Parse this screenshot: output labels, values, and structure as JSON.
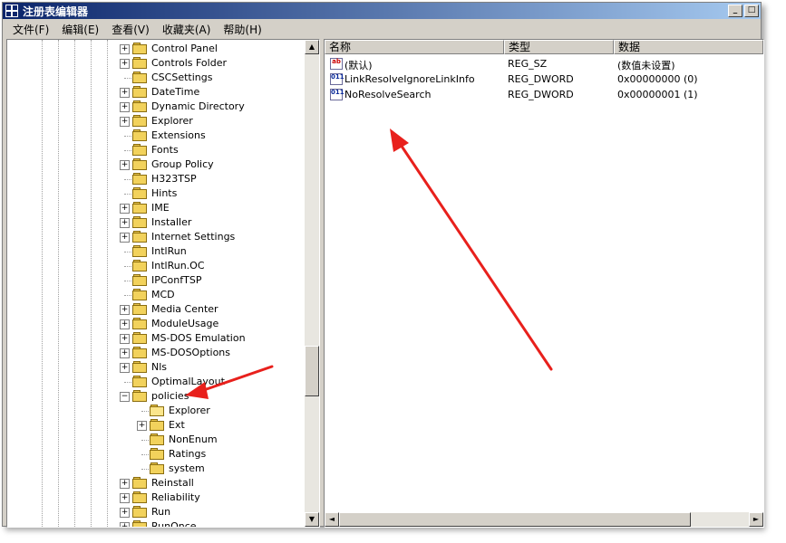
{
  "window": {
    "title": "注册表编辑器",
    "minimize": "_",
    "maximize": "□"
  },
  "menu": [
    "文件(F)",
    "编辑(E)",
    "查看(V)",
    "收藏夹(A)",
    "帮助(H)"
  ],
  "tree": {
    "items": [
      {
        "label": "Control Panel",
        "level": 0,
        "expander": "plus",
        "open": false
      },
      {
        "label": "Controls Folder",
        "level": 0,
        "expander": "plus",
        "open": false
      },
      {
        "label": "CSCSettings",
        "level": 0,
        "expander": "none",
        "open": false
      },
      {
        "label": "DateTime",
        "level": 0,
        "expander": "plus",
        "open": false
      },
      {
        "label": "Dynamic Directory",
        "level": 0,
        "expander": "plus",
        "open": false
      },
      {
        "label": "Explorer",
        "level": 0,
        "expander": "plus",
        "open": false
      },
      {
        "label": "Extensions",
        "level": 0,
        "expander": "none",
        "open": false
      },
      {
        "label": "Fonts",
        "level": 0,
        "expander": "none",
        "open": false
      },
      {
        "label": "Group Policy",
        "level": 0,
        "expander": "plus",
        "open": false
      },
      {
        "label": "H323TSP",
        "level": 0,
        "expander": "none",
        "open": false
      },
      {
        "label": "Hints",
        "level": 0,
        "expander": "none",
        "open": false
      },
      {
        "label": "IME",
        "level": 0,
        "expander": "plus",
        "open": false
      },
      {
        "label": "Installer",
        "level": 0,
        "expander": "plus",
        "open": false
      },
      {
        "label": "Internet Settings",
        "level": 0,
        "expander": "plus",
        "open": false
      },
      {
        "label": "IntlRun",
        "level": 0,
        "expander": "none",
        "open": false
      },
      {
        "label": "IntlRun.OC",
        "level": 0,
        "expander": "none",
        "open": false
      },
      {
        "label": "IPConfTSP",
        "level": 0,
        "expander": "none",
        "open": false
      },
      {
        "label": "MCD",
        "level": 0,
        "expander": "none",
        "open": false
      },
      {
        "label": "Media Center",
        "level": 0,
        "expander": "plus",
        "open": false
      },
      {
        "label": "ModuleUsage",
        "level": 0,
        "expander": "plus",
        "open": false
      },
      {
        "label": "MS-DOS Emulation",
        "level": 0,
        "expander": "plus",
        "open": false
      },
      {
        "label": "MS-DOSOptions",
        "level": 0,
        "expander": "plus",
        "open": false
      },
      {
        "label": "Nls",
        "level": 0,
        "expander": "plus",
        "open": false
      },
      {
        "label": "OptimalLayout",
        "level": 0,
        "expander": "none",
        "open": false
      },
      {
        "label": "policies",
        "level": 0,
        "expander": "minus",
        "open": false
      },
      {
        "label": "Explorer",
        "level": 1,
        "expander": "none",
        "open": true
      },
      {
        "label": "Ext",
        "level": 1,
        "expander": "plus",
        "open": false
      },
      {
        "label": "NonEnum",
        "level": 1,
        "expander": "none",
        "open": false
      },
      {
        "label": "Ratings",
        "level": 1,
        "expander": "none",
        "open": false
      },
      {
        "label": "system",
        "level": 1,
        "expander": "none",
        "open": false
      },
      {
        "label": "Reinstall",
        "level": 0,
        "expander": "plus",
        "open": false
      },
      {
        "label": "Reliability",
        "level": 0,
        "expander": "plus",
        "open": false
      },
      {
        "label": "Run",
        "level": 0,
        "expander": "plus",
        "open": false
      },
      {
        "label": "RunOnce",
        "level": 0,
        "expander": "plus",
        "open": false
      }
    ]
  },
  "list": {
    "columns": [
      "名称",
      "类型",
      "数据"
    ],
    "rows": [
      {
        "icon": "string-value-icon",
        "glyph": "ab",
        "name": "(默认)",
        "type": "REG_SZ",
        "data": "(数值未设置)"
      },
      {
        "icon": "dword-value-icon",
        "glyph": "011",
        "name": "LinkResolveIgnoreLinkInfo",
        "type": "REG_DWORD",
        "data": "0x00000000 (0)"
      },
      {
        "icon": "dword-value-icon",
        "glyph": "011",
        "name": "NoResolveSearch",
        "type": "REG_DWORD",
        "data": "0x00000001 (1)"
      }
    ]
  },
  "scroll": {
    "up": "▲",
    "down": "▼",
    "left": "◄",
    "right": "►"
  },
  "colors": {
    "annotation_arrow": "#e8201c",
    "titlebar": "#0a246a"
  }
}
